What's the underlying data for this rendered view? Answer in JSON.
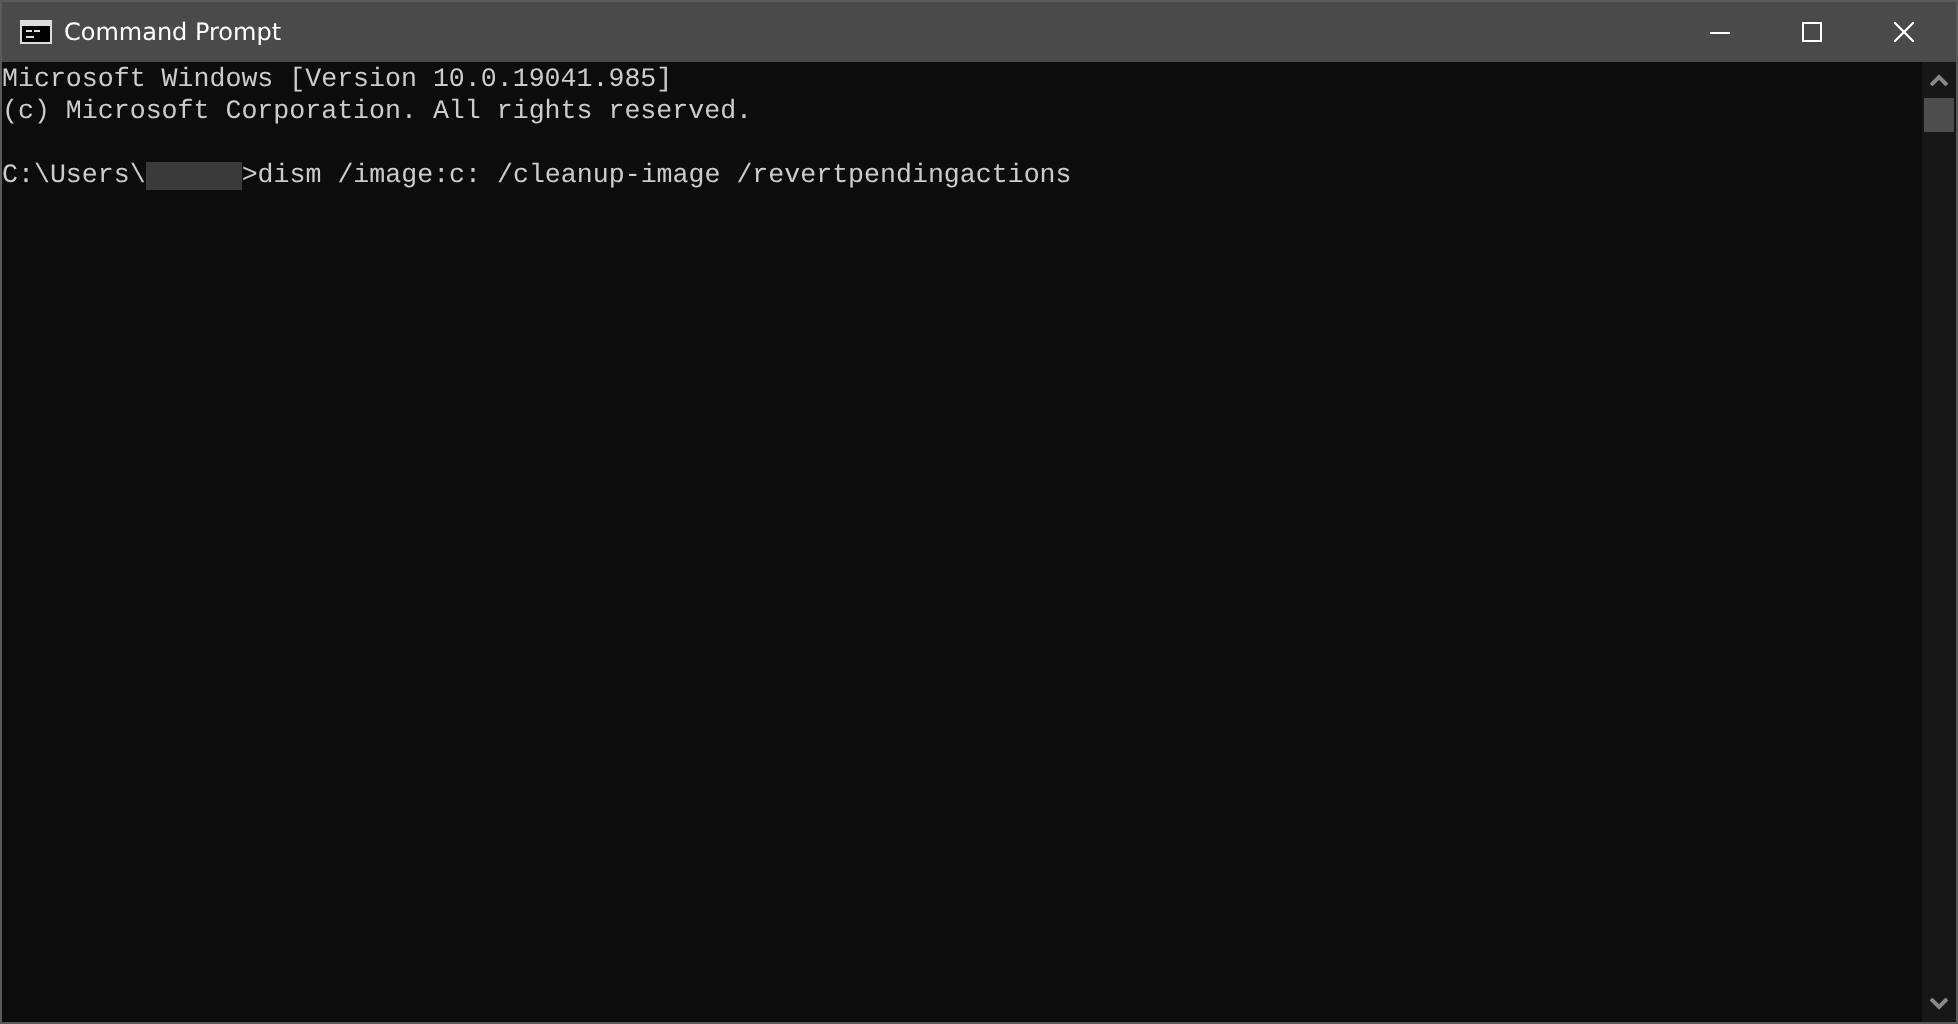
{
  "window": {
    "title": "Command Prompt"
  },
  "console": {
    "lines": [
      {
        "kind": "text",
        "text": "Microsoft Windows [Version 10.0.19041.985]"
      },
      {
        "kind": "text",
        "text": "(c) Microsoft Corporation. All rights reserved."
      },
      {
        "kind": "blank"
      },
      {
        "kind": "prompt",
        "path": "C:\\Users\\",
        "redacted": true,
        "command": ">dism /image:c: /cleanup-image /revertpendingactions"
      }
    ]
  }
}
